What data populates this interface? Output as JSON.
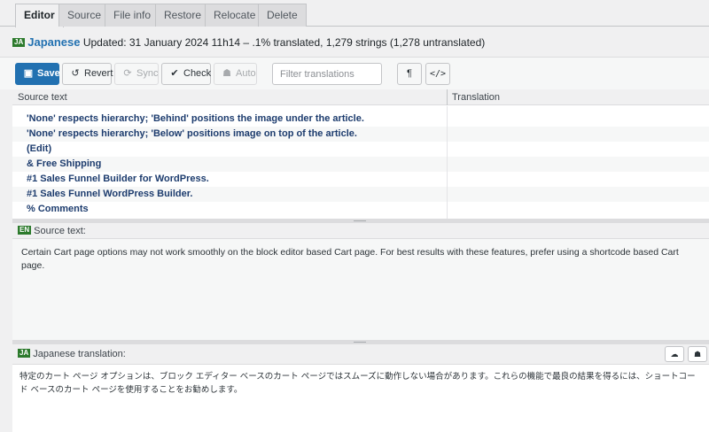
{
  "tabs": [
    {
      "label": "Editor",
      "active": true
    },
    {
      "label": "Source",
      "active": false
    },
    {
      "label": "File info",
      "active": false
    },
    {
      "label": "Restore",
      "active": false
    },
    {
      "label": "Relocate",
      "active": false
    },
    {
      "label": "Delete",
      "active": false
    }
  ],
  "header": {
    "lang_code": "JA",
    "language": "Japanese",
    "status": "Updated: 31 January 2024 11h14 – .1% translated, 1,279 strings (1,278 untranslated)"
  },
  "toolbar": {
    "save": {
      "label": "Save",
      "icon": "floppy-icon"
    },
    "revert": {
      "label": "Revert",
      "icon": "undo-icon"
    },
    "sync": {
      "label": "Sync",
      "icon": "sync-icon"
    },
    "check": {
      "label": "Check",
      "icon": "check-icon"
    },
    "auto": {
      "label": "Auto",
      "icon": "robot-icon"
    },
    "filter_placeholder": "Filter translations",
    "pilcrow": "¶",
    "code": "</>"
  },
  "grid": {
    "col_source": "Source text",
    "col_translation": "Translation",
    "rows": [
      "'None' respects hierarchy; 'Behind' positions the image under the article.",
      "'None' respects hierarchy; 'Below' positions image on top of the article.",
      "(Edit)",
      "& Free Shipping",
      "#1 Sales Funnel Builder for WordPress.",
      "#1 Sales Funnel WordPress Builder.",
      "% Comments"
    ]
  },
  "source_panel": {
    "lang_code": "EN",
    "label": "Source text:",
    "text": "Certain Cart page options may not work smoothly on the block editor based Cart page. For best results with these features, prefer using a shortcode based Cart page."
  },
  "translation_panel": {
    "lang_code": "JA",
    "label": "Japanese translation:",
    "text": "特定のカート ページ オプションは、ブロック エディター ベースのカート ページではスムーズに動作しない場合があります。これらの機能で最良の結果を得るには、ショートコード ベースのカート ページを使用することをお勧めします。"
  },
  "colors": {
    "primary": "#2271b1",
    "badge_green": "#2c7a2c",
    "string_text": "#1d3c6e"
  }
}
